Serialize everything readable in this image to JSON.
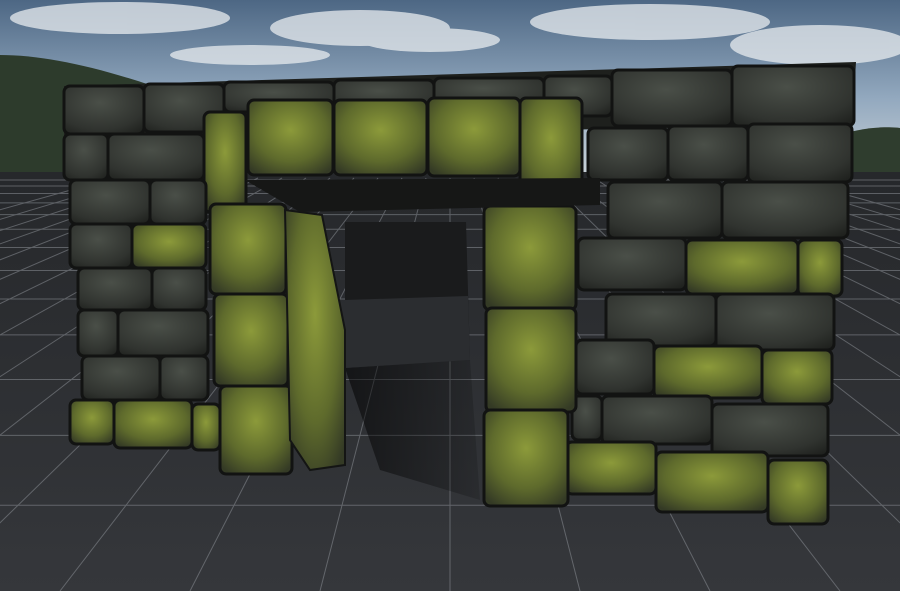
{
  "scene": {
    "sky_top": "#4f6a86",
    "sky_mid": "#8fa7bf",
    "sky_horizon": "#c9d2d8",
    "forest": "#2c3a2a",
    "grid_floor": "#303236",
    "grid_line": "#8c9096",
    "stone_dark": "#2d2f2c",
    "stone_mid": "#3e423c",
    "moss": "#6f7d2c",
    "moss_light": "#8c9a3a",
    "mortar": "#141514"
  }
}
